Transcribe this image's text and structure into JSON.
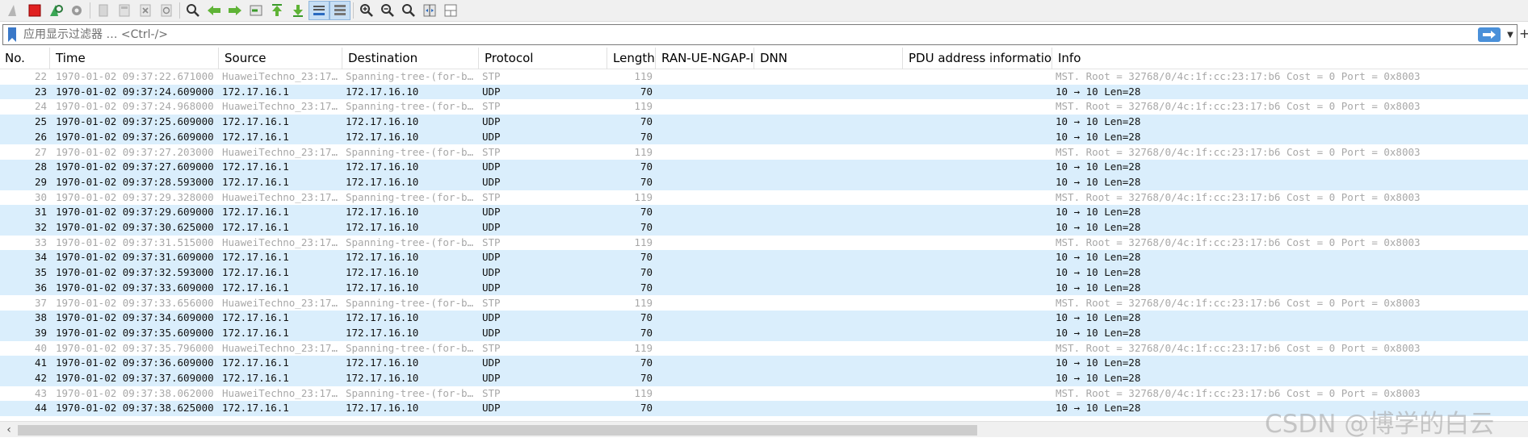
{
  "filter": {
    "placeholder": "应用显示过滤器 … <Ctrl-/>"
  },
  "columns": [
    {
      "key": "no",
      "label": "No."
    },
    {
      "key": "time",
      "label": "Time"
    },
    {
      "key": "source",
      "label": "Source"
    },
    {
      "key": "destination",
      "label": "Destination"
    },
    {
      "key": "protocol",
      "label": "Protocol"
    },
    {
      "key": "length",
      "label": "Length"
    },
    {
      "key": "ranue",
      "label": "RAN-UE-NGAP-ID"
    },
    {
      "key": "dnn",
      "label": "DNN"
    },
    {
      "key": "pdu",
      "label": "PDU address information"
    },
    {
      "key": "info",
      "label": "Info"
    }
  ],
  "colors": {
    "udp_row": "#daeefc",
    "stp_row": "#ffffff",
    "stp_text": "#a8a8a8"
  },
  "packets": [
    {
      "no": "22",
      "time": "1970-01-02 09:37:22.671000",
      "source": "HuaweiTechno_23:17…",
      "destination": "Spanning-tree-(for-b…",
      "protocol": "STP",
      "length": "119",
      "info": "MST. Root = 32768/0/4c:1f:cc:23:17:b6  Cost = 0  Port = 0x8003"
    },
    {
      "no": "23",
      "time": "1970-01-02 09:37:24.609000",
      "source": "172.17.16.1",
      "destination": "172.17.16.10",
      "protocol": "UDP",
      "length": "70",
      "info": "10 → 10 Len=28"
    },
    {
      "no": "24",
      "time": "1970-01-02 09:37:24.968000",
      "source": "HuaweiTechno_23:17…",
      "destination": "Spanning-tree-(for-b…",
      "protocol": "STP",
      "length": "119",
      "info": "MST. Root = 32768/0/4c:1f:cc:23:17:b6  Cost = 0  Port = 0x8003"
    },
    {
      "no": "25",
      "time": "1970-01-02 09:37:25.609000",
      "source": "172.17.16.1",
      "destination": "172.17.16.10",
      "protocol": "UDP",
      "length": "70",
      "info": "10 → 10 Len=28"
    },
    {
      "no": "26",
      "time": "1970-01-02 09:37:26.609000",
      "source": "172.17.16.1",
      "destination": "172.17.16.10",
      "protocol": "UDP",
      "length": "70",
      "info": "10 → 10 Len=28"
    },
    {
      "no": "27",
      "time": "1970-01-02 09:37:27.203000",
      "source": "HuaweiTechno_23:17…",
      "destination": "Spanning-tree-(for-b…",
      "protocol": "STP",
      "length": "119",
      "info": "MST. Root = 32768/0/4c:1f:cc:23:17:b6  Cost = 0  Port = 0x8003"
    },
    {
      "no": "28",
      "time": "1970-01-02 09:37:27.609000",
      "source": "172.17.16.1",
      "destination": "172.17.16.10",
      "protocol": "UDP",
      "length": "70",
      "info": "10 → 10 Len=28"
    },
    {
      "no": "29",
      "time": "1970-01-02 09:37:28.593000",
      "source": "172.17.16.1",
      "destination": "172.17.16.10",
      "protocol": "UDP",
      "length": "70",
      "info": "10 → 10 Len=28"
    },
    {
      "no": "30",
      "time": "1970-01-02 09:37:29.328000",
      "source": "HuaweiTechno_23:17…",
      "destination": "Spanning-tree-(for-b…",
      "protocol": "STP",
      "length": "119",
      "info": "MST. Root = 32768/0/4c:1f:cc:23:17:b6  Cost = 0  Port = 0x8003"
    },
    {
      "no": "31",
      "time": "1970-01-02 09:37:29.609000",
      "source": "172.17.16.1",
      "destination": "172.17.16.10",
      "protocol": "UDP",
      "length": "70",
      "info": "10 → 10 Len=28"
    },
    {
      "no": "32",
      "time": "1970-01-02 09:37:30.625000",
      "source": "172.17.16.1",
      "destination": "172.17.16.10",
      "protocol": "UDP",
      "length": "70",
      "info": "10 → 10 Len=28"
    },
    {
      "no": "33",
      "time": "1970-01-02 09:37:31.515000",
      "source": "HuaweiTechno_23:17…",
      "destination": "Spanning-tree-(for-b…",
      "protocol": "STP",
      "length": "119",
      "info": "MST. Root = 32768/0/4c:1f:cc:23:17:b6  Cost = 0  Port = 0x8003"
    },
    {
      "no": "34",
      "time": "1970-01-02 09:37:31.609000",
      "source": "172.17.16.1",
      "destination": "172.17.16.10",
      "protocol": "UDP",
      "length": "70",
      "info": "10 → 10 Len=28"
    },
    {
      "no": "35",
      "time": "1970-01-02 09:37:32.593000",
      "source": "172.17.16.1",
      "destination": "172.17.16.10",
      "protocol": "UDP",
      "length": "70",
      "info": "10 → 10 Len=28"
    },
    {
      "no": "36",
      "time": "1970-01-02 09:37:33.609000",
      "source": "172.17.16.1",
      "destination": "172.17.16.10",
      "protocol": "UDP",
      "length": "70",
      "info": "10 → 10 Len=28"
    },
    {
      "no": "37",
      "time": "1970-01-02 09:37:33.656000",
      "source": "HuaweiTechno_23:17…",
      "destination": "Spanning-tree-(for-b…",
      "protocol": "STP",
      "length": "119",
      "info": "MST. Root = 32768/0/4c:1f:cc:23:17:b6  Cost = 0  Port = 0x8003"
    },
    {
      "no": "38",
      "time": "1970-01-02 09:37:34.609000",
      "source": "172.17.16.1",
      "destination": "172.17.16.10",
      "protocol": "UDP",
      "length": "70",
      "info": "10 → 10 Len=28"
    },
    {
      "no": "39",
      "time": "1970-01-02 09:37:35.609000",
      "source": "172.17.16.1",
      "destination": "172.17.16.10",
      "protocol": "UDP",
      "length": "70",
      "info": "10 → 10 Len=28"
    },
    {
      "no": "40",
      "time": "1970-01-02 09:37:35.796000",
      "source": "HuaweiTechno_23:17…",
      "destination": "Spanning-tree-(for-b…",
      "protocol": "STP",
      "length": "119",
      "info": "MST. Root = 32768/0/4c:1f:cc:23:17:b6  Cost = 0  Port = 0x8003"
    },
    {
      "no": "41",
      "time": "1970-01-02 09:37:36.609000",
      "source": "172.17.16.1",
      "destination": "172.17.16.10",
      "protocol": "UDP",
      "length": "70",
      "info": "10 → 10 Len=28"
    },
    {
      "no": "42",
      "time": "1970-01-02 09:37:37.609000",
      "source": "172.17.16.1",
      "destination": "172.17.16.10",
      "protocol": "UDP",
      "length": "70",
      "info": "10 → 10 Len=28"
    },
    {
      "no": "43",
      "time": "1970-01-02 09:37:38.062000",
      "source": "HuaweiTechno_23:17…",
      "destination": "Spanning-tree-(for-b…",
      "protocol": "STP",
      "length": "119",
      "info": "MST. Root = 32768/0/4c:1f:cc:23:17:b6  Cost = 0  Port = 0x8003"
    },
    {
      "no": "44",
      "time": "1970-01-02 09:37:38.625000",
      "source": "172.17.16.1",
      "destination": "172.17.16.10",
      "protocol": "UDP",
      "length": "70",
      "info": "10 → 10 Len=28"
    }
  ],
  "watermark": "CSDN @博学的白云"
}
